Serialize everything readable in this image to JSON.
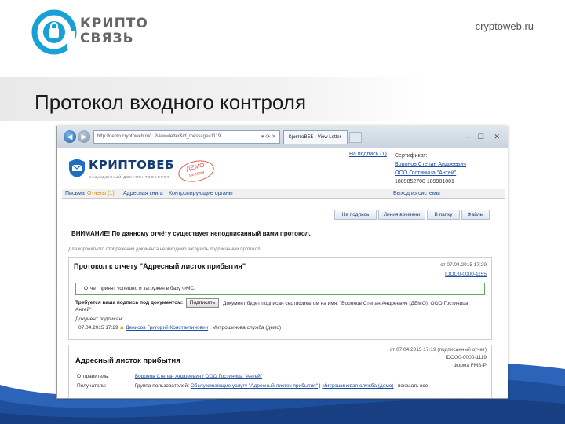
{
  "slide": {
    "brand_line1": "КРИПТО",
    "brand_line2": "СВЯЗЬ",
    "site_url": "cryptoweb.ru",
    "title": "Протокол входного контроля",
    "accent_color": "#1aa0d8",
    "wave_color": "#2b64b8"
  },
  "browser": {
    "address": "http://demo.cryptoweb.ru/...?view=letter&id_message=1119",
    "tab_title": "КриптоВЕБ - View Letter",
    "back_icon": "arrow-left-icon",
    "forward_icon": "arrow-right-icon"
  },
  "page": {
    "logo_text": "КРИПТОВЕБ",
    "logo_sub": "ЗАЩИЩЕННЫЙ ДОКУМЕНТООБОРОТ",
    "demo_stamp": "ДЕМО",
    "demo_stamp_sub": "версия",
    "unsigned_link": "На подпись (1)",
    "cert_label": "Сертификат:",
    "cert_name": "Воронов Степан Андреевич",
    "cert_org": "ООО Гостиница \"Антей\"",
    "cert_numbers": "1809852700 189901001",
    "nav": {
      "letters": "Письма",
      "reports": "Отчеты (1)",
      "address_book": "Адресная книга",
      "authorities": "Контролирующие органы",
      "logout": "Выход из системы"
    },
    "buttons": {
      "to_sign": "На подпись",
      "timeline": "Линия времени",
      "to_basket": "В папку",
      "files": "Файлы"
    },
    "warning": "ВНИМАНИЕ! По данному отчёту существует неподписанный вами протокол.",
    "hint": "Для корректного отображения документа необходимо загрузить подписанный протокол"
  },
  "protocol": {
    "title": "Протокол к отчету \"Адресный листок прибытия\"",
    "date": "от 07.04.2015 17:29",
    "number": "IDOO0-0000-1155",
    "accepted_text": "Отчет принят успешно и загружен в базу ФМС.",
    "sign_required_label": "Требуется ваша подпись под документом:",
    "sign_button": "Подписать",
    "sign_note": "Документ будет подписан сертификатом на имя: \"Воронов Степан Андреевич (ДЕМО), ООО Гостиница",
    "sign_note2": "Антей\"",
    "sent_label": "Документ подписан:",
    "sent_date": "07.04.2015 17:29",
    "sent_person": "Денисов Григорий Константинович",
    "sent_org": ", Митрошинова служба (демо)"
  },
  "report": {
    "date": "от 07.04.2015 17:19 (подписанный отчет)",
    "number": "IDOO0-0000-1119",
    "form": "Форма FMS-P",
    "title": "Адресный листок прибытия",
    "sender_label": "Отправитель:",
    "sender": "Воронов Степан Андреевич | ООО Гостиница \"Антей\"",
    "recipient_label": "Получатели:",
    "recipient_prefix": "Группа пользователей:",
    "recipient_service": "Обслуживающие услугу \"Адресный листок прибытия\"",
    "recipient_sep": "|",
    "recipient_org": "Митрошиновая служба (демо)",
    "recipient_suffix": "| показать все"
  }
}
